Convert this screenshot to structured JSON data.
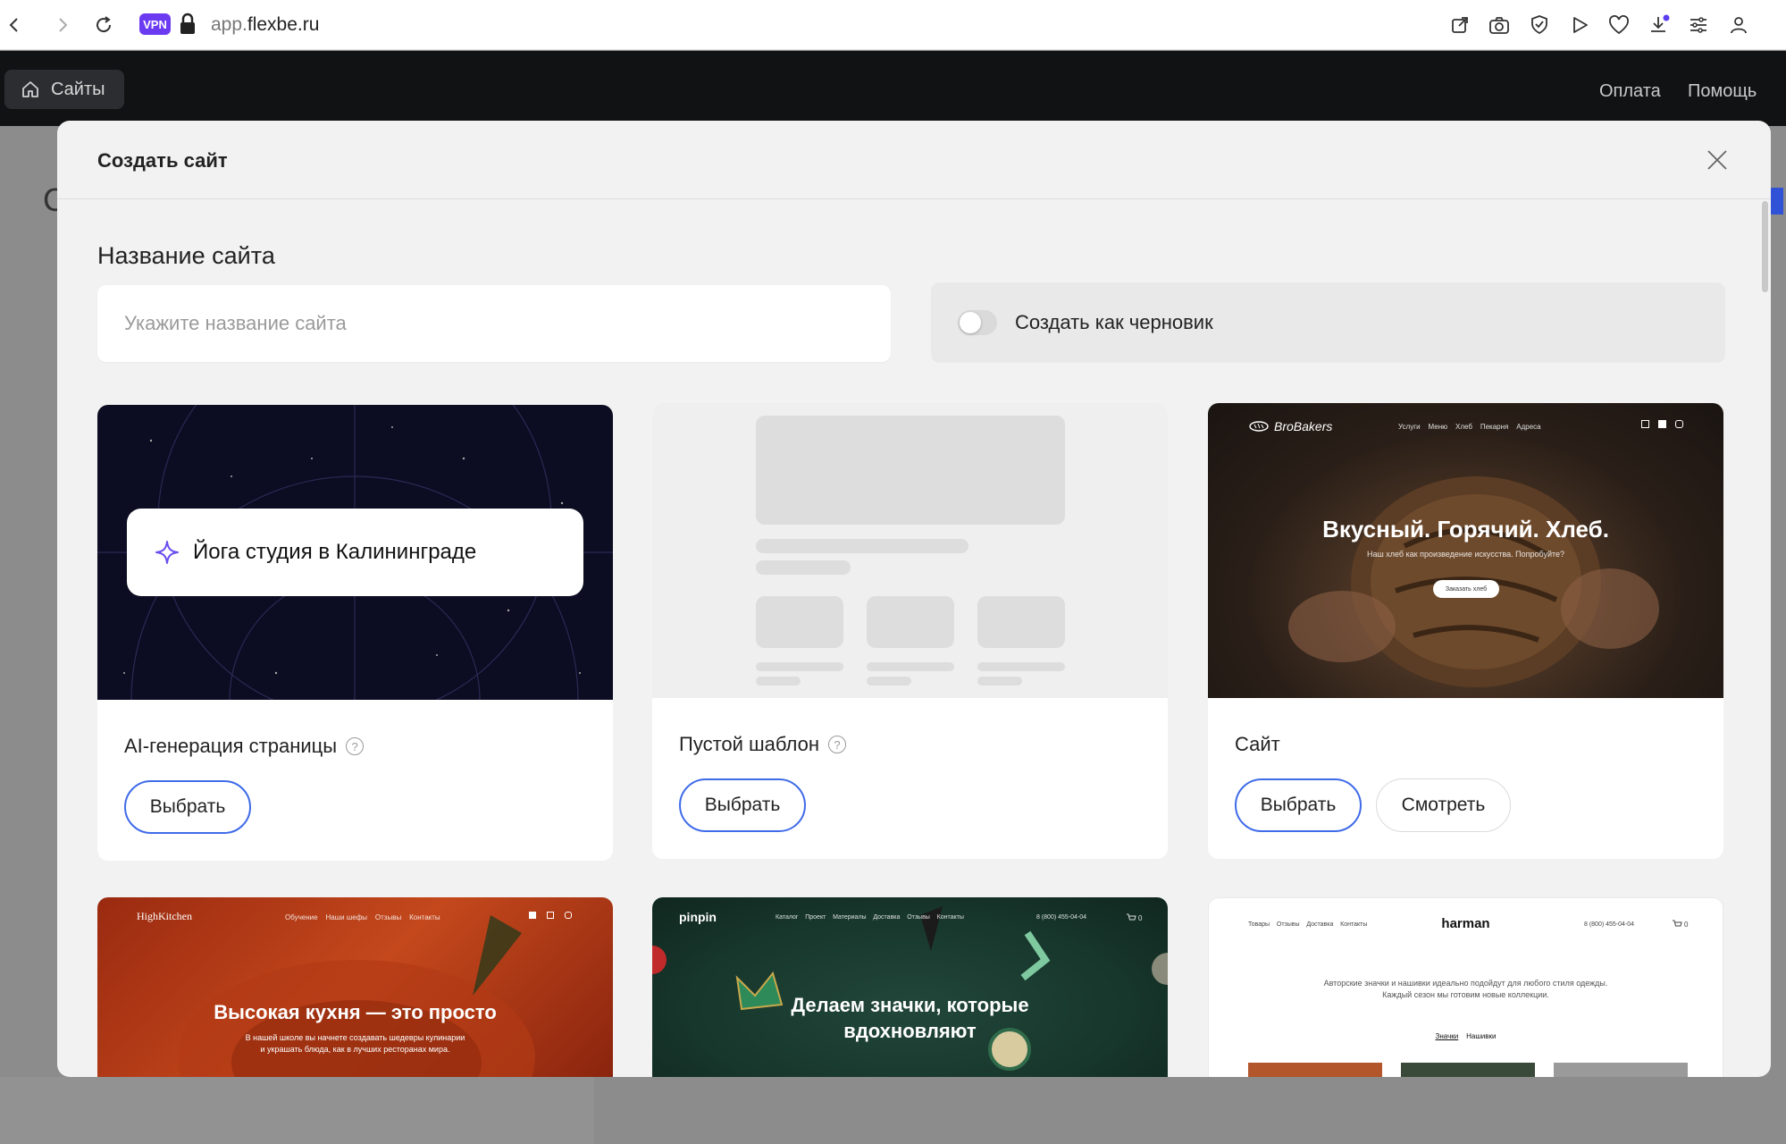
{
  "browser": {
    "vpn_label": "VPN",
    "url_prefix": "app.",
    "url_domain": "flexbe.ru"
  },
  "appbar": {
    "sites_label": "Сайты",
    "links": [
      "Оплата",
      "Помощь"
    ]
  },
  "page": {
    "partial_letter": "С"
  },
  "modal": {
    "title": "Создать сайт",
    "name_label": "Название сайта",
    "name_placeholder": "Укажите название сайта",
    "draft_label": "Создать как черновик",
    "draft_enabled": false,
    "accent_color": "#3f6be8"
  },
  "cards": [
    {
      "title": "AI-генерация страницы",
      "has_help": true,
      "help_glyph": "?",
      "select_label": "Выбрать",
      "preview": {
        "prompt_text": "Йога студия в Калининграде"
      }
    },
    {
      "title": "Пустой шаблон",
      "has_help": true,
      "help_glyph": "?",
      "select_label": "Выбрать"
    },
    {
      "title": "Сайт",
      "select_label": "Выбрать",
      "view_label": "Смотреть",
      "preview": {
        "brand": "BroBakers",
        "nav": [
          "Услуги",
          "Меню",
          "Хлеб",
          "Пекарня",
          "Адреса"
        ],
        "headline": "Вкусный. Горячий. Хлеб.",
        "subline": "Наш хлеб как произведение искусства. Попробуйте?",
        "cta": "Заказать хлеб"
      }
    }
  ],
  "bottom_cards": [
    {
      "brand": "HighKitchen",
      "nav": [
        "Обучение",
        "Наши шефы",
        "Отзывы",
        "Контакты"
      ],
      "headline": "Высокая кухня — это просто",
      "subline_1": "В нашей школе вы начнете создавать шедевры кулинарии",
      "subline_2": "и украшать блюда, как в лучших ресторанах мира."
    },
    {
      "brand": "pinpin",
      "nav": [
        "Каталог",
        "Проект",
        "Материалы",
        "Доставка",
        "Отзывы",
        "Контакты"
      ],
      "phone": "8 (800) 455-04-04",
      "cart_count": "0",
      "headline_1": "Делаем значки, которые",
      "headline_2": "вдохновляют"
    },
    {
      "brand": "harman",
      "nav": [
        "Товары",
        "Отзывы",
        "Доставка",
        "Контакты"
      ],
      "phone": "8 (800) 455-04-04",
      "cart_count": "0",
      "text_1": "Авторские значки и нашивки идеально подойдут для любого стиля одежды.",
      "text_2": "Каждый сезон мы готовим новые коллекции.",
      "tabs": [
        "Значки",
        "Нашивки"
      ]
    }
  ]
}
